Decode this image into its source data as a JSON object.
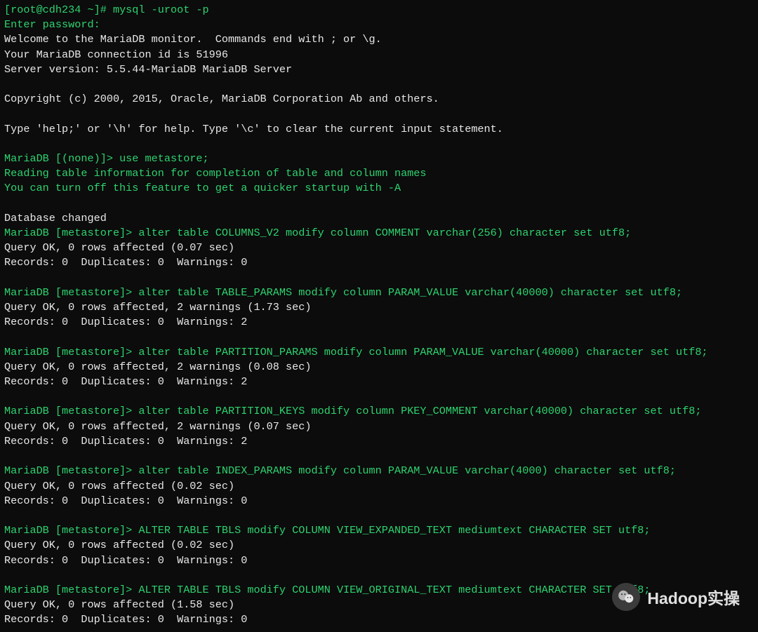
{
  "shell": {
    "prompt": "[root@cdh234 ~]# ",
    "command": "mysql -uroot -p"
  },
  "login": {
    "enter_password": "Enter password:",
    "welcome": "Welcome to the MariaDB monitor.  Commands end with ; or \\g.",
    "conn_id": "Your MariaDB connection id is 51996",
    "server_version": "Server version: 5.5.44-MariaDB MariaDB Server",
    "copyright": "Copyright (c) 2000, 2015, Oracle, MariaDB Corporation Ab and others.",
    "help": "Type 'help;' or '\\h' for help. Type '\\c' to clear the current input statement."
  },
  "use_db": {
    "prompt": "MariaDB [(none)]> ",
    "command": "use metastore;",
    "reading": "Reading table information for completion of table and column names",
    "turn_off": "You can turn off this feature to get a quicker startup with -A",
    "changed": "Database changed"
  },
  "q1": {
    "prompt": "MariaDB [metastore]> ",
    "sql": "alter table COLUMNS_V2 modify column COMMENT varchar(256) character set utf8;",
    "result1": "Query OK, 0 rows affected (0.07 sec)",
    "result2": "Records: 0  Duplicates: 0  Warnings: 0"
  },
  "q2": {
    "prompt": "MariaDB [metastore]> ",
    "sql": "alter table TABLE_PARAMS modify column PARAM_VALUE varchar(40000) character set utf8;",
    "result1": "Query OK, 0 rows affected, 2 warnings (1.73 sec)",
    "result2": "Records: 0  Duplicates: 0  Warnings: 2"
  },
  "q3": {
    "prompt": "MariaDB [metastore]> ",
    "sql": "alter table PARTITION_PARAMS modify column PARAM_VALUE varchar(40000) character set utf8;",
    "result1": "Query OK, 0 rows affected, 2 warnings (0.08 sec)",
    "result2": "Records: 0  Duplicates: 0  Warnings: 2"
  },
  "q4": {
    "prompt": "MariaDB [metastore]> ",
    "sql": "alter table PARTITION_KEYS modify column PKEY_COMMENT varchar(40000) character set utf8;",
    "result1": "Query OK, 0 rows affected, 2 warnings (0.07 sec)",
    "result2": "Records: 0  Duplicates: 0  Warnings: 2"
  },
  "q5": {
    "prompt": "MariaDB [metastore]> ",
    "sql": "alter table INDEX_PARAMS modify column PARAM_VALUE varchar(4000) character set utf8;",
    "result1": "Query OK, 0 rows affected (0.02 sec)",
    "result2": "Records: 0  Duplicates: 0  Warnings: 0"
  },
  "q6": {
    "prompt": "MariaDB [metastore]> ",
    "sql": "ALTER TABLE TBLS modify COLUMN VIEW_EXPANDED_TEXT mediumtext CHARACTER SET utf8;",
    "result1": "Query OK, 0 rows affected (0.02 sec)",
    "result2": "Records: 0  Duplicates: 0  Warnings: 0"
  },
  "q7": {
    "prompt": "MariaDB [metastore]> ",
    "sql": "ALTER TABLE TBLS modify COLUMN VIEW_ORIGINAL_TEXT mediumtext CHARACTER SET utf8;",
    "result1": "Query OK, 0 rows affected (1.58 sec)",
    "result2": "Records: 0  Duplicates: 0  Warnings: 0"
  },
  "watermark": {
    "text": "Hadoop实操"
  }
}
